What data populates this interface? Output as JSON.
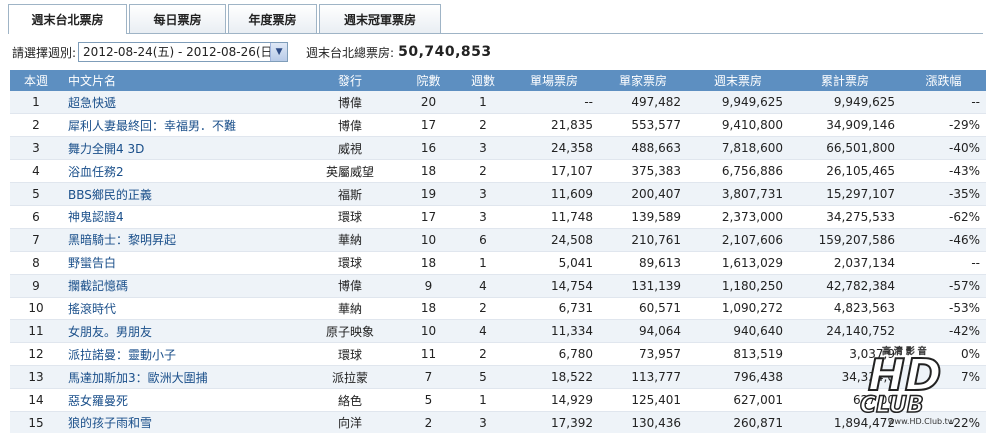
{
  "tabs": [
    {
      "label": "週末台北票房"
    },
    {
      "label": "每日票房"
    },
    {
      "label": "年度票房"
    },
    {
      "label": "週末冠軍票房"
    }
  ],
  "toolbar": {
    "week_label": "請選擇週別:",
    "week_value": "2012-08-24(五) - 2012-08-26(日)",
    "total_label": "週末台北總票房:",
    "total_value": "50,740,853"
  },
  "table": {
    "headers": [
      "本週",
      "中文片名",
      "發行",
      "院數",
      "週數",
      "單場票房",
      "單家票房",
      "週末票房",
      "累計票房",
      "漲跌幅"
    ],
    "rows": [
      [
        "1",
        "超急快遞",
        "博偉",
        "20",
        "1",
        "--",
        "497,482",
        "9,949,625",
        "9,949,625",
        "--"
      ],
      [
        "2",
        "犀利人妻最終回：幸福男．不難",
        "博偉",
        "17",
        "2",
        "21,835",
        "553,577",
        "9,410,800",
        "34,909,146",
        "-29%"
      ],
      [
        "3",
        "舞力全開4 3D",
        "威視",
        "16",
        "3",
        "24,358",
        "488,663",
        "7,818,600",
        "66,501,800",
        "-40%"
      ],
      [
        "4",
        "浴血任務2",
        "英屬威望",
        "18",
        "2",
        "17,107",
        "375,383",
        "6,756,886",
        "26,105,465",
        "-43%"
      ],
      [
        "5",
        "BBS鄉民的正義",
        "福斯",
        "19",
        "3",
        "11,609",
        "200,407",
        "3,807,731",
        "15,297,107",
        "-35%"
      ],
      [
        "6",
        "神鬼認證4",
        "環球",
        "17",
        "3",
        "11,748",
        "139,589",
        "2,373,000",
        "34,275,533",
        "-62%"
      ],
      [
        "7",
        "黑暗騎士：黎明昇起",
        "華納",
        "10",
        "6",
        "24,508",
        "210,761",
        "2,107,606",
        "159,207,586",
        "-46%"
      ],
      [
        "8",
        "野蠻告白",
        "環球",
        "18",
        "1",
        "5,041",
        "89,613",
        "1,613,029",
        "2,037,134",
        "--"
      ],
      [
        "9",
        "攔截記憶碼",
        "博偉",
        "9",
        "4",
        "14,754",
        "131,139",
        "1,180,250",
        "42,782,384",
        "-57%"
      ],
      [
        "10",
        "搖滾時代",
        "華納",
        "18",
        "2",
        "6,731",
        "60,571",
        "1,090,272",
        "4,823,563",
        "-53%"
      ],
      [
        "11",
        "女朋友。男朋友",
        "原子映象",
        "10",
        "4",
        "11,334",
        "94,064",
        "940,640",
        "24,140,752",
        "-42%"
      ],
      [
        "12",
        "派拉諾曼：靈動小子",
        "環球",
        "11",
        "2",
        "6,780",
        "73,957",
        "813,519",
        "3,037,9",
        "0%"
      ],
      [
        "13",
        "馬達加斯加3：歐洲大圍捕",
        "派拉蒙",
        "7",
        "5",
        "18,522",
        "113,777",
        "796,438",
        "34,334,0",
        "7%"
      ],
      [
        "14",
        "惡女羅曼死",
        "絡色",
        "5",
        "1",
        "14,929",
        "125,401",
        "627,001",
        "627,00",
        ""
      ],
      [
        "15",
        "狼的孩子雨和雪",
        "向洋",
        "2",
        "3",
        "17,392",
        "130,436",
        "260,871",
        "1,894,472",
        "-22%"
      ]
    ]
  },
  "watermark": {
    "brand": "HD",
    "sub": "CLUB",
    "chars": "高 清 影 音",
    "url": "www.HD.Club.tw"
  }
}
